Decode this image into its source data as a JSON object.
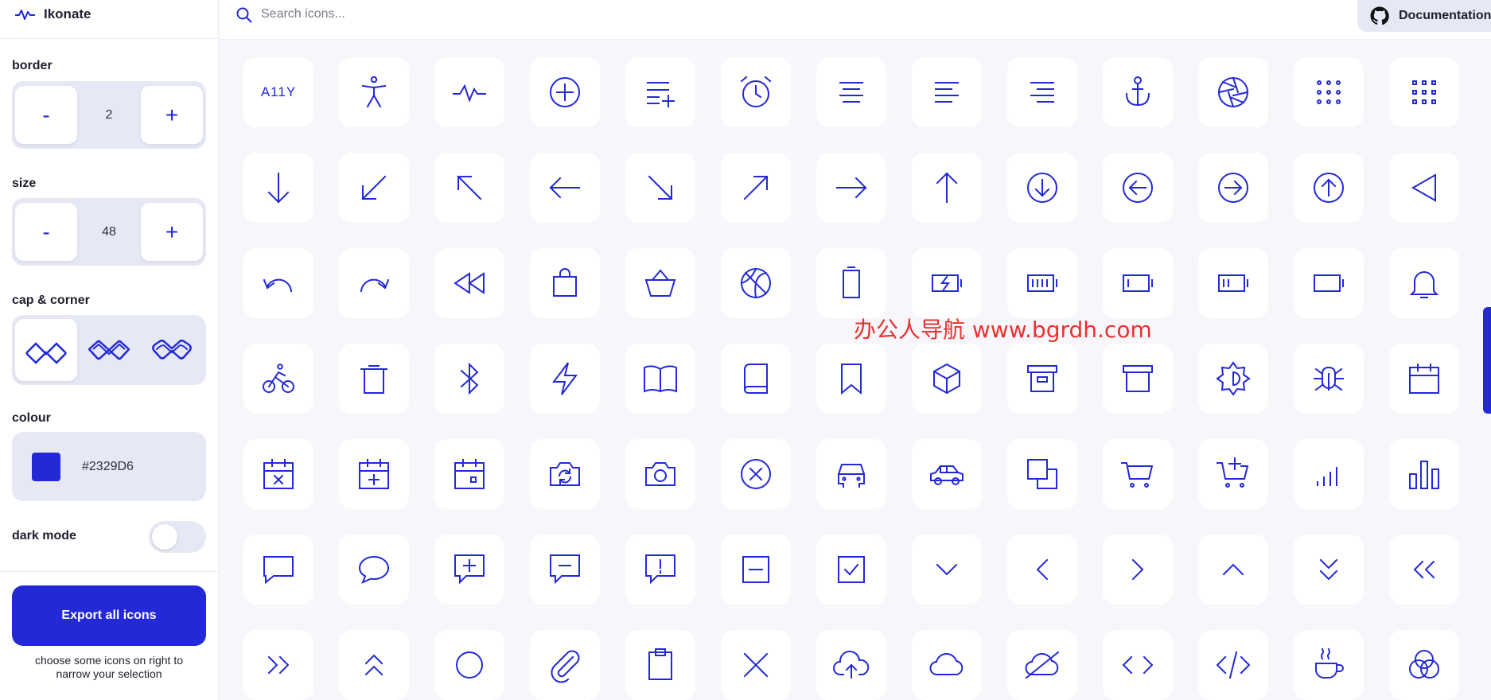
{
  "app": {
    "name": "Ikonate"
  },
  "search": {
    "placeholder": "Search icons..."
  },
  "header": {
    "documentation_label": "Documentation"
  },
  "sidebar": {
    "border": {
      "label": "border",
      "value": "2",
      "minus": "-",
      "plus": "+"
    },
    "size": {
      "label": "size",
      "value": "48",
      "minus": "-",
      "plus": "+"
    },
    "cap_corner": {
      "label": "cap & corner",
      "options": [
        "miter-square",
        "round-bevel",
        "round-round"
      ],
      "selected": 0
    },
    "colour": {
      "label": "colour",
      "value": "#2329D6"
    },
    "dark_mode": {
      "label": "dark mode",
      "enabled": false
    },
    "export": {
      "label": "Export all icons",
      "hint": "choose some icons on right to narrow your selection"
    }
  },
  "theme": {
    "accent": "#2329D6",
    "panel": "#E6E8F5",
    "background": "#F7F7FB"
  },
  "watermark": "办公人导航 www.bgrdh.com",
  "icons": [
    "a11y",
    "activity",
    "activity-alt",
    "add",
    "add-to-list",
    "alarm",
    "align-center",
    "align-left",
    "align-right",
    "anchor",
    "aperture",
    "apps",
    "apps-alt",
    "arrow-down",
    "arrow-down-left",
    "arrow-up-left",
    "arrow-left",
    "arrow-down-right",
    "arrow-up-right",
    "arrow-right",
    "arrow-up",
    "arrow-down-circle",
    "arrow-left-circle",
    "arrow-right-circle",
    "arrow-up-circle",
    "back",
    "arrow-undo",
    "arrow-redo",
    "rewind",
    "bag",
    "basket",
    "basketball",
    "battery",
    "battery-charging",
    "battery-full",
    "battery-low",
    "battery-medium",
    "battery-empty",
    "bell",
    "bike",
    "trash",
    "bluetooth",
    "bolt",
    "book-opened",
    "book",
    "bookmark",
    "box",
    "box-alt",
    "archive",
    "brightness",
    "bug",
    "calendar",
    "calendar-remove",
    "calendar-add",
    "calendar-event",
    "camera-switch",
    "camera",
    "cancel",
    "car",
    "car-alt",
    "copy",
    "cart",
    "cart-add",
    "signal",
    "chart",
    "chat",
    "chat-bubble",
    "chat-add",
    "chat-remove",
    "chat-error",
    "minus-square",
    "checkbox",
    "chevron-down",
    "chevron-left",
    "chevron-right",
    "chevron-up",
    "chevrons-down",
    "chevrons-left",
    "chevrons-right",
    "chevrons-up",
    "circle",
    "clip",
    "clipboard",
    "close",
    "cloud-upload",
    "cloud",
    "cloud-off",
    "code",
    "code-alt",
    "coffee",
    "colours"
  ]
}
